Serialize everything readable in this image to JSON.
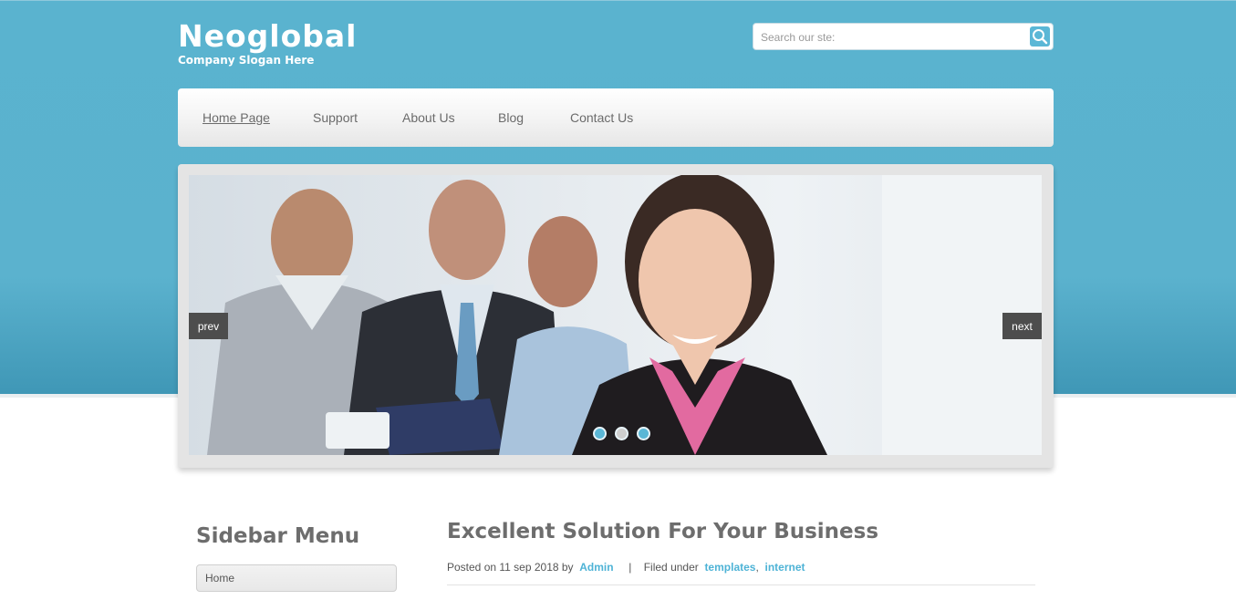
{
  "header": {
    "logo_title": "Neoglobal",
    "slogan": "Company Slogan Here",
    "search_placeholder": "Search our ste:"
  },
  "nav": {
    "items": [
      {
        "label": "Home Page",
        "active": true
      },
      {
        "label": "Support"
      },
      {
        "label": "About Us"
      },
      {
        "label": "Blog"
      },
      {
        "label": "Contact Us"
      }
    ]
  },
  "slider": {
    "prev_label": "prev",
    "next_label": "next",
    "dots": 3,
    "active_dot": 2,
    "image_desc_icon": "business-people-photo"
  },
  "sidebar": {
    "title": "Sidebar Menu",
    "items": [
      {
        "label": "Home"
      }
    ]
  },
  "post": {
    "title": "Excellent Solution For Your Business",
    "posted_on": "Posted on 11 sep 2018 by",
    "author": "Admin",
    "separator": "|",
    "filed_under": "Filed under",
    "tags": [
      "templates",
      "internet"
    ],
    "tag_separator": ","
  },
  "colors": {
    "header_bg": "#5bb2ce",
    "link": "#4eb3d6",
    "text_heading": "#6d6d6d"
  }
}
